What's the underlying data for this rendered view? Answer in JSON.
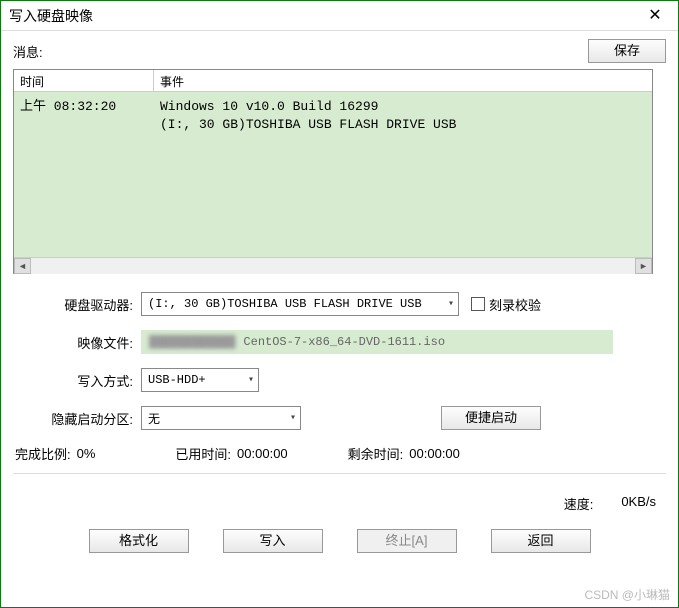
{
  "window": {
    "title": "写入硬盘映像",
    "close_glyph": "✕"
  },
  "msg": {
    "label": "消息:",
    "save_button": "保存"
  },
  "log": {
    "col_time": "时间",
    "col_event": "事件",
    "rows": [
      {
        "time": "",
        "event": "Windows 10 v10.0 Build 16299"
      },
      {
        "time": "上午 08:32:20",
        "event": "(I:, 30 GB)TOSHIBA USB FLASH DRIVE USB"
      }
    ],
    "scroll_left": "◄",
    "scroll_right": "►"
  },
  "fields": {
    "drive_label": "硬盘驱动器:",
    "drive_value": "(I:, 30 GB)TOSHIBA USB FLASH DRIVE USB",
    "verify_label": "刻录校验",
    "image_label": "映像文件:",
    "image_value_tail": "CentOS-7-x86_64-DVD-1611.iso",
    "write_mode_label": "写入方式:",
    "write_mode_value": "USB-HDD+",
    "hidden_partition_label": "隐藏启动分区:",
    "hidden_partition_value": "无",
    "quick_boot_button": "便捷启动"
  },
  "stats": {
    "complete_label": "完成比例:",
    "complete_value": "0%",
    "elapsed_label": "已用时间:",
    "elapsed_value": "00:00:00",
    "remaining_label": "剩余时间:",
    "remaining_value": "00:00:00",
    "speed_label": "速度:",
    "speed_value": "0KB/s"
  },
  "buttons": {
    "format": "格式化",
    "write": "写入",
    "terminate": "终止[A]",
    "back": "返回"
  },
  "combo_arrow": "▾",
  "watermark": "CSDN @小琳猫"
}
